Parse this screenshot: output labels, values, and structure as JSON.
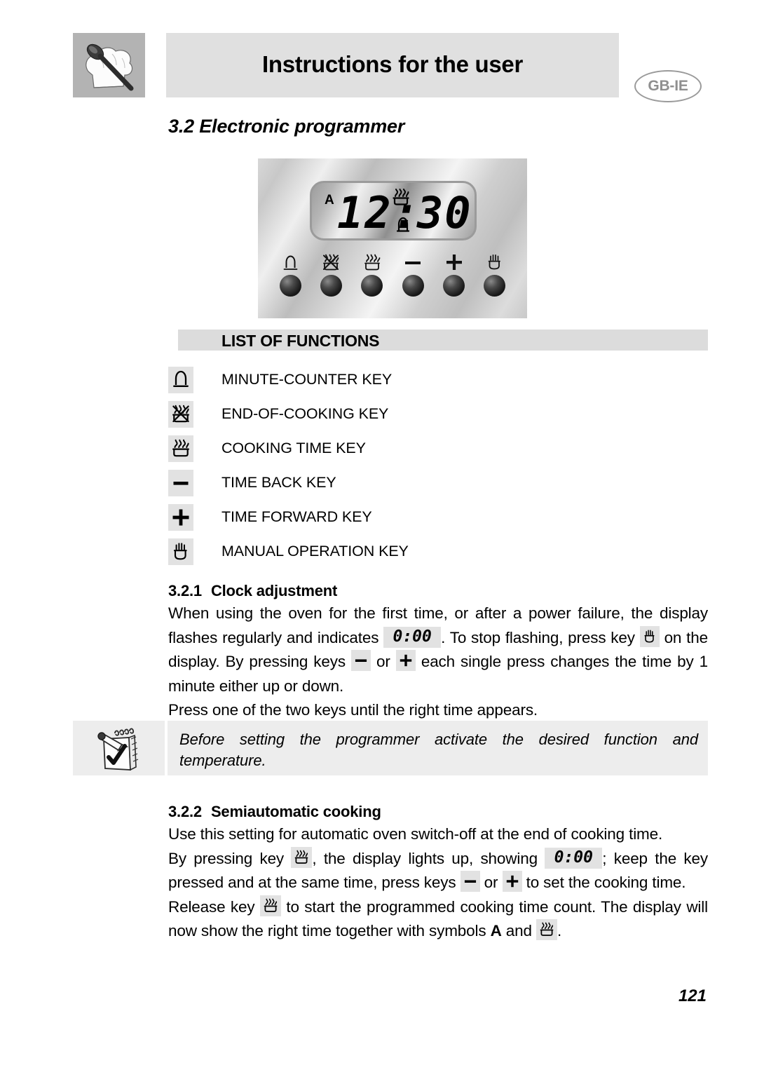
{
  "header": {
    "title": "Instructions for the user",
    "language_badge": "GB-IE",
    "logo_icon": "chef-hat-spoon-logo"
  },
  "section": {
    "number_title": "3.2 Electronic programmer"
  },
  "programmer_panel": {
    "display": {
      "auto_indicator": "A",
      "hours": "12",
      "separator": ":",
      "minutes": "30",
      "symbol_top": "cooking-time-icon",
      "symbol_bottom": "minute-counter-bell-icon"
    },
    "keys": [
      {
        "icon": "minute-counter-bell-icon",
        "name": "minute-counter-key"
      },
      {
        "icon": "end-of-cooking-icon",
        "name": "end-of-cooking-key"
      },
      {
        "icon": "cooking-time-icon",
        "name": "cooking-time-key"
      },
      {
        "icon": "minus-icon",
        "name": "time-back-key"
      },
      {
        "icon": "plus-icon",
        "name": "time-forward-key"
      },
      {
        "icon": "manual-hand-icon",
        "name": "manual-operation-key"
      }
    ]
  },
  "list_of_functions": {
    "heading": "LIST OF FUNCTIONS",
    "rows": [
      {
        "icon": "minute-counter-bell-icon",
        "label": "MINUTE-COUNTER KEY"
      },
      {
        "icon": "end-of-cooking-icon",
        "label": "END-OF-COOKING KEY"
      },
      {
        "icon": "cooking-time-icon",
        "label": "COOKING TIME KEY"
      },
      {
        "icon": "minus-icon",
        "label": "TIME BACK KEY"
      },
      {
        "icon": "plus-icon",
        "label": "TIME FORWARD KEY"
      },
      {
        "icon": "manual-hand-icon",
        "label": "MANUAL OPERATION KEY"
      }
    ]
  },
  "clock_adjustment": {
    "number": "3.2.1",
    "title": "Clock adjustment",
    "text_1": "When using the oven for the first time, or after a power failure, the display flashes regularly and indicates",
    "lcd_value": "0:00",
    "text_2": ". To stop flashing, press key",
    "text_3": "on the display. By pressing keys",
    "text_or": "or",
    "text_4": "each single press changes the time by 1 minute either up or down.",
    "text_5": "Press one of the two keys until the right time appears."
  },
  "note": {
    "icon": "notepad-pencil-check-icon",
    "text": "Before setting the programmer activate the desired function and temperature."
  },
  "semiautomatic_cooking": {
    "number": "3.2.2",
    "title": "Semiautomatic cooking",
    "text_1": "Use this setting for automatic oven switch-off at the end of cooking time.",
    "text_2": "By pressing key",
    "text_3": ", the display lights up, showing",
    "lcd_value": "0:00",
    "text_4": "; keep the key pressed and at the same time, press keys",
    "text_or": "or",
    "text_5": "to set the cooking time.",
    "text_6": "Release key",
    "text_7": "to start the programmed cooking time count. The display will now show the right time together with symbols",
    "symbol_a": "A",
    "text_8": "and",
    "text_9": "."
  },
  "page_number": "121",
  "colors": {
    "header_bar": "#e0e0e0",
    "logo_box": "#b3b3b3",
    "functions_bar": "#dcdcdc",
    "icon_chip": "#e2e2e2",
    "note_bg": "#ededed",
    "badge_gray": "#8f8f8f"
  }
}
